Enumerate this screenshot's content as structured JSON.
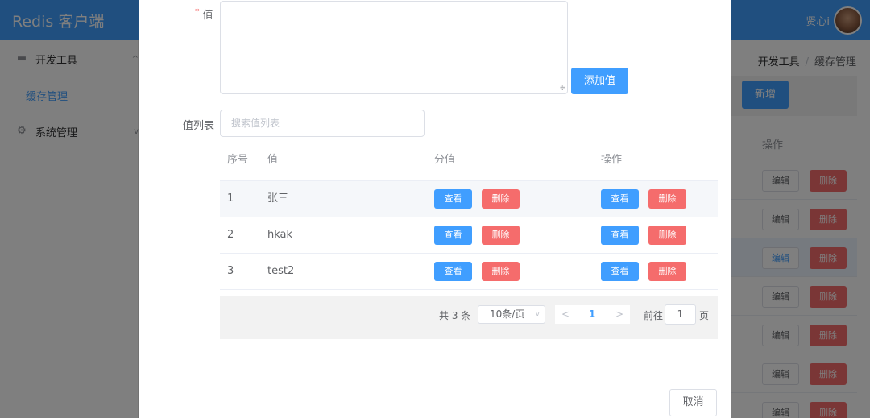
{
  "app": {
    "title": "Redis 客户端",
    "user_name": "贤心i"
  },
  "sidebar": {
    "menu_dev": "开发工具",
    "menu_cache": "缓存管理",
    "menu_system": "系统管理",
    "arrow_up": "^",
    "arrow_down": "v"
  },
  "breadcrumb": {
    "parent": "开发工具",
    "separator": "/",
    "current": "缓存管理"
  },
  "background": {
    "new_label": "新增",
    "ops_header": "操作",
    "edit_label": "编辑",
    "delete_label": "删除"
  },
  "dialog": {
    "value_label": "值",
    "required_mark": "*",
    "add_value_label": "添加值",
    "list_label": "值列表",
    "search_placeholder": "搜索值列表",
    "columns": [
      "序号",
      "值",
      "分值",
      "操作"
    ],
    "rows": [
      {
        "index": "1",
        "value": "张三"
      },
      {
        "index": "2",
        "value": "hkak"
      },
      {
        "index": "3",
        "value": "test2"
      }
    ],
    "view_label": "查看",
    "delete_label": "删除",
    "pagination": {
      "total": "共 3 条",
      "page_size": "10条/页",
      "current_page": "1",
      "goto_label": "前往",
      "goto_value": "1",
      "page_unit": "页",
      "prev": "<",
      "next": ">",
      "select_chevron": "v"
    },
    "cancel_label": "取消"
  },
  "colors": {
    "primary": "#409eff",
    "danger": "#f56c6c",
    "overlay": "rgba(0,0,0,0.5)"
  }
}
